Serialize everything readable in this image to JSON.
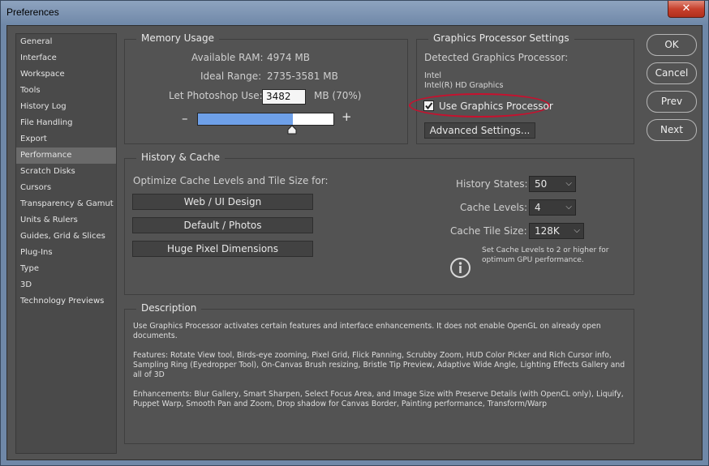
{
  "window": {
    "title": "Preferences",
    "close_glyph": "✕"
  },
  "sidebar": {
    "items": [
      "General",
      "Interface",
      "Workspace",
      "Tools",
      "History Log",
      "File Handling",
      "Export",
      "Performance",
      "Scratch Disks",
      "Cursors",
      "Transparency & Gamut",
      "Units & Rulers",
      "Guides, Grid & Slices",
      "Plug-Ins",
      "Type",
      "3D",
      "Technology Previews"
    ],
    "selected": "Performance"
  },
  "memory": {
    "title": "Memory Usage",
    "available_label": "Available RAM:",
    "available_value": "4974 MB",
    "ideal_label": "Ideal Range:",
    "ideal_value": "2735-3581 MB",
    "use_label": "Let Photoshop Use:",
    "use_value": "3482",
    "use_suffix": "MB (70%)",
    "minus": "–",
    "plus": "+",
    "slider_percent": 70
  },
  "gpu": {
    "title": "Graphics Processor Settings",
    "detected_label": "Detected Graphics Processor:",
    "vendor": "Intel",
    "model": "Intel(R) HD Graphics",
    "use_gpu_label": "Use Graphics Processor",
    "use_gpu_checked": true,
    "advanced_button": "Advanced Settings..."
  },
  "history_cache": {
    "title": "History & Cache",
    "optimize_label": "Optimize Cache Levels and Tile Size for:",
    "buttons": [
      "Web / UI Design",
      "Default / Photos",
      "Huge Pixel Dimensions"
    ],
    "history_states_label": "History States:",
    "history_states_value": "50",
    "cache_levels_label": "Cache Levels:",
    "cache_levels_value": "4",
    "tile_size_label": "Cache Tile Size:",
    "tile_size_value": "128K",
    "info_line1": "Set Cache Levels to 2 or higher for",
    "info_line2": "optimum GPU performance."
  },
  "description": {
    "title": "Description",
    "p1": "Use Graphics Processor activates certain features and interface enhancements. It does not enable OpenGL on already open documents.",
    "p2": "Features: Rotate View tool, Birds-eye zooming, Pixel Grid, Flick Panning, Scrubby Zoom, HUD Color Picker and Rich Cursor info, Sampling Ring (Eyedropper Tool), On-Canvas Brush resizing, Bristle Tip Preview, Adaptive Wide Angle, Lighting Effects Gallery and all of 3D",
    "p3": "Enhancements: Blur Gallery, Smart Sharpen, Select Focus Area, and Image Size with Preserve Details (with OpenCL only), Liquify, Puppet Warp, Smooth Pan and Zoom, Drop shadow for Canvas Border, Painting performance, Transform/Warp"
  },
  "actions": {
    "ok": "OK",
    "cancel": "Cancel",
    "prev": "Prev",
    "next": "Next"
  },
  "colors": {
    "highlight_ring": "#c8102e",
    "slider_fill": "#6ea0e8"
  }
}
